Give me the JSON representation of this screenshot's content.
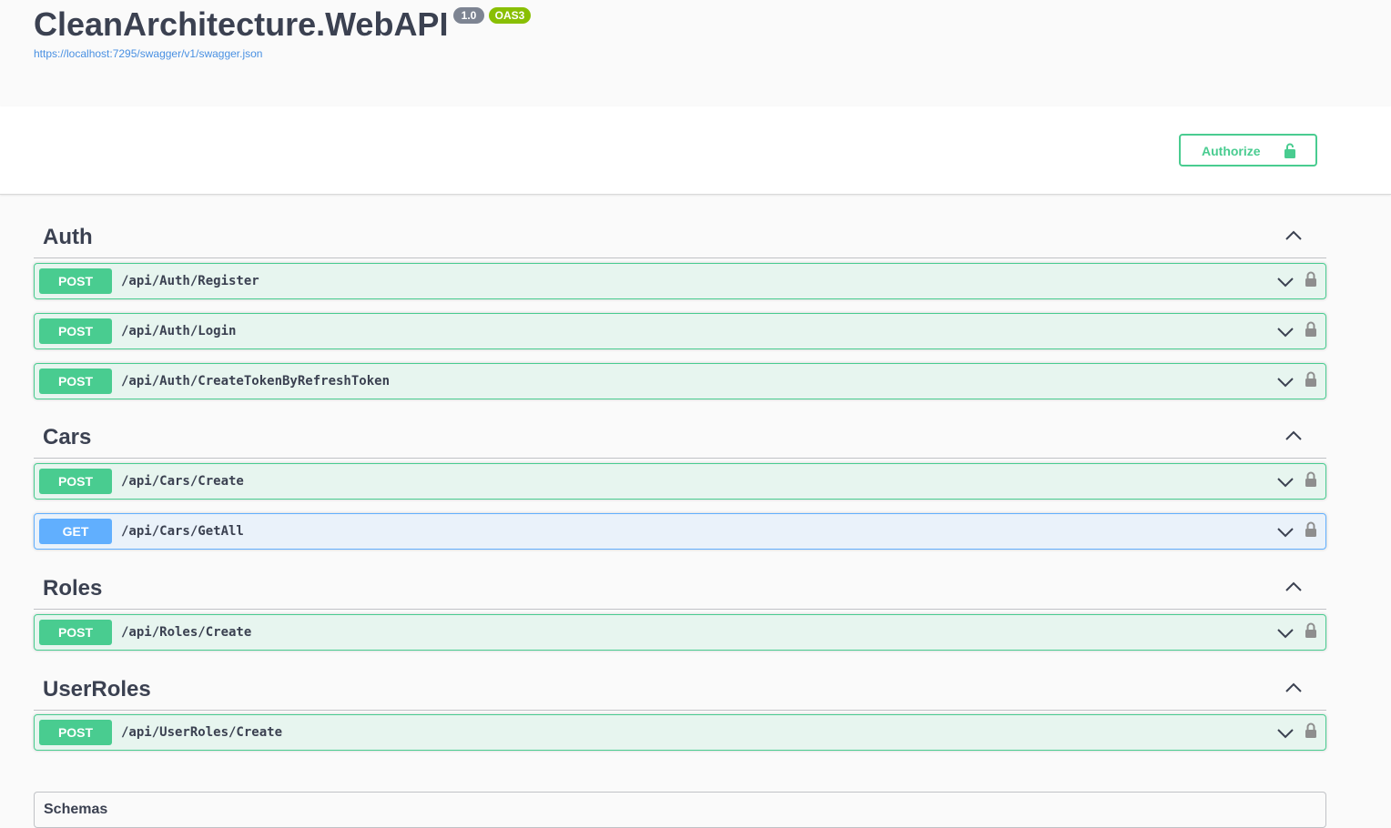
{
  "info": {
    "title": "CleanArchitecture.WebAPI",
    "version": "1.0",
    "oas_badge": "OAS3",
    "spec_url": "https://localhost:7295/swagger/v1/swagger.json"
  },
  "authorize": {
    "label": "Authorize",
    "icon": "unlock-icon"
  },
  "colors": {
    "post": "#49cc90",
    "get": "#61affe",
    "text": "#3b4151",
    "link": "#4990e2"
  },
  "tags": [
    {
      "name": "Auth",
      "operations": [
        {
          "method": "POST",
          "path": "/api/Auth/Register"
        },
        {
          "method": "POST",
          "path": "/api/Auth/Login"
        },
        {
          "method": "POST",
          "path": "/api/Auth/CreateTokenByRefreshToken"
        }
      ]
    },
    {
      "name": "Cars",
      "operations": [
        {
          "method": "POST",
          "path": "/api/Cars/Create"
        },
        {
          "method": "GET",
          "path": "/api/Cars/GetAll"
        }
      ]
    },
    {
      "name": "Roles",
      "operations": [
        {
          "method": "POST",
          "path": "/api/Roles/Create"
        }
      ]
    },
    {
      "name": "UserRoles",
      "operations": [
        {
          "method": "POST",
          "path": "/api/UserRoles/Create"
        }
      ]
    }
  ],
  "models": {
    "label": "Schemas"
  }
}
